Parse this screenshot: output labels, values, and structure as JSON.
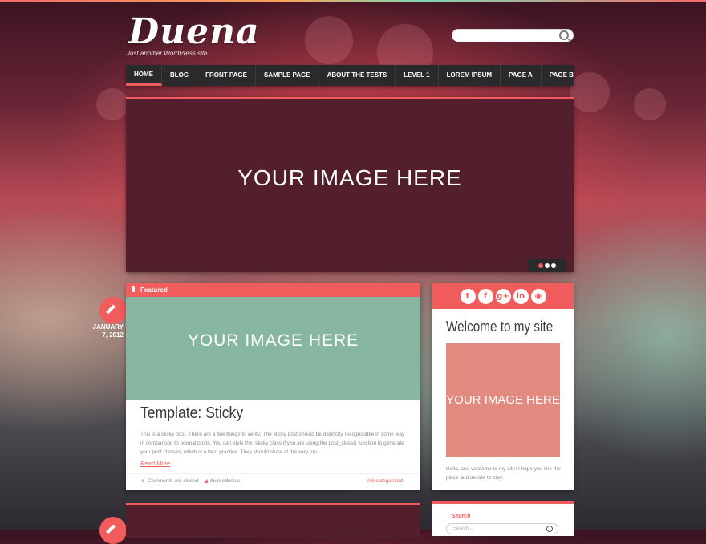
{
  "site": {
    "title": "Duena",
    "tagline": "Just another WordPress site"
  },
  "search_top": {
    "placeholder": ""
  },
  "nav": [
    "HOME",
    "BLOG",
    "FRONT PAGE",
    "SAMPLE PAGE",
    "ABOUT THE TESTS",
    "LEVEL 1",
    "LOREM IPSUM",
    "PAGE A",
    "PAGE B"
  ],
  "slider": {
    "placeholder": "YOUR IMAGE HERE",
    "dots": 3,
    "active_dot": 0
  },
  "post": {
    "date": "JANUARY 7, 2012",
    "featured_label": "Featured",
    "image_placeholder": "YOUR IMAGE HERE",
    "title": "Template: Sticky",
    "excerpt": "This is a sticky post. There are a few things to verify: The sticky post should be distinctly recognizable in some way in comparison to normal posts. You can style the .sticky class if you are using the post_class() function to generate your post classes, which is a best practice. They should show at the very top...",
    "read_more": "Read More",
    "comments": "Comments are closed",
    "author": "themedemos",
    "category": "#Uncategorized"
  },
  "sidebar": {
    "social_icons": [
      "twitter-icon",
      "facebook-icon",
      "google-plus-icon",
      "linkedin-icon",
      "rss-icon"
    ],
    "social_glyphs": [
      "t",
      "f",
      "g+",
      "in",
      "◉"
    ],
    "title": "Welcome to my site",
    "image_placeholder": "YOUR IMAGE HERE",
    "welcome_text": "Hello, and welcome to my site! I hope you like the place and decide to stay."
  },
  "search_widget": {
    "label": "Search",
    "placeholder": "Search ..."
  },
  "colors": {
    "accent": "#f15c5c",
    "slider_bg": "#541f2d",
    "post_image_bg": "#87b7a3",
    "sidebar_image_bg": "#e38a80",
    "nav_bg": "#2a2a2c"
  }
}
